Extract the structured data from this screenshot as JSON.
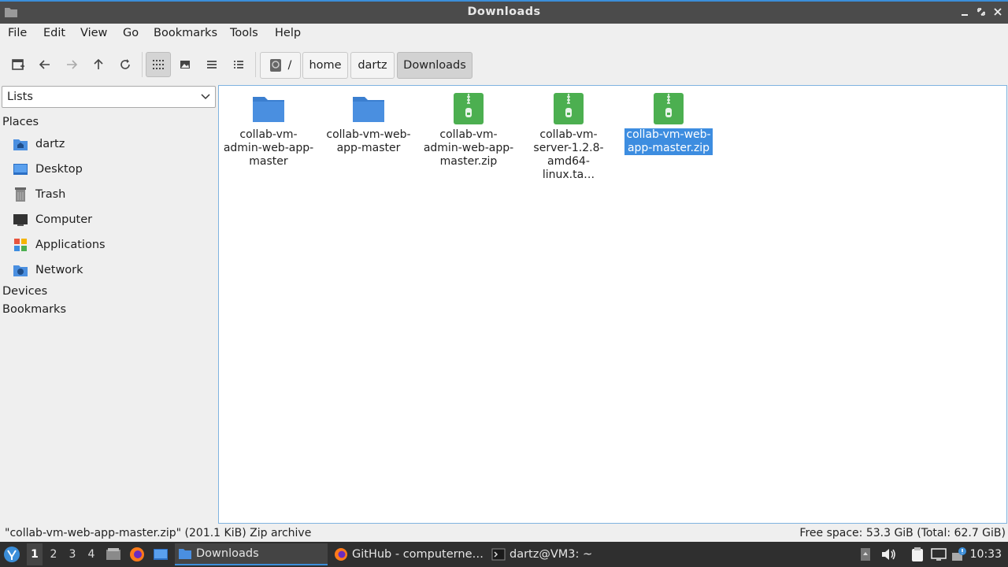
{
  "window": {
    "title": "Downloads"
  },
  "menu": [
    "File",
    "Edit",
    "View",
    "Go",
    "Bookmarks",
    "Tools",
    "Help"
  ],
  "breadcrumb": {
    "root": "/",
    "items": [
      "home",
      "dartz",
      "Downloads"
    ]
  },
  "sidebar": {
    "combo_value": "Lists",
    "places_header": "Places",
    "places": [
      {
        "label": "dartz",
        "icon": "home-folder-icon"
      },
      {
        "label": "Desktop",
        "icon": "desktop-icon"
      },
      {
        "label": "Trash",
        "icon": "trash-icon"
      },
      {
        "label": "Computer",
        "icon": "computer-icon"
      },
      {
        "label": "Applications",
        "icon": "applications-icon"
      },
      {
        "label": "Network",
        "icon": "network-icon"
      }
    ],
    "devices_header": "Devices",
    "bookmarks_header": "Bookmarks"
  },
  "files": [
    {
      "name": "collab-vm-admin-web-app-master",
      "display": [
        "collab-vm-",
        "admin-web-app-",
        "master"
      ],
      "type": "folder"
    },
    {
      "name": "collab-vm-web-app-master",
      "display": [
        "collab-vm-web-",
        "app-master"
      ],
      "type": "folder"
    },
    {
      "name": "collab-vm-admin-web-app-master.zip",
      "display": [
        "collab-vm-",
        "admin-web-app-",
        "master.zip"
      ],
      "type": "archive"
    },
    {
      "name": "collab-vm-server-1.2.8-amd64-linux.ta…",
      "display": [
        "collab-vm-",
        "server-1.2.8-",
        "amd64-linux.ta…"
      ],
      "type": "archive"
    },
    {
      "name": "collab-vm-web-app-master.zip",
      "display": [
        "collab-vm-web-",
        "app-master.zip"
      ],
      "type": "archive",
      "selected": true
    }
  ],
  "status": {
    "left": "\"collab-vm-web-app-master.zip\" (201.1 KiB) Zip archive",
    "right": "Free space: 53.3 GiB (Total: 62.7 GiB)"
  },
  "taskbar": {
    "workspaces": [
      "1",
      "2",
      "3",
      "4"
    ],
    "active_workspace": "1",
    "tasks": [
      {
        "label": "Downloads",
        "icon": "folder-icon",
        "active": true
      },
      {
        "label": "GitHub - computerne…",
        "icon": "firefox-icon",
        "active": false
      },
      {
        "label": "dartz@VM3: ~",
        "icon": "terminal-icon",
        "active": false
      }
    ],
    "clock": "10:33"
  },
  "colors": {
    "accent": "#3d8de0",
    "folder": "#4a8fe0",
    "archive": "#4caf50",
    "taskbar": "#2f2f2f",
    "titlebar": "#4b4b4b"
  }
}
